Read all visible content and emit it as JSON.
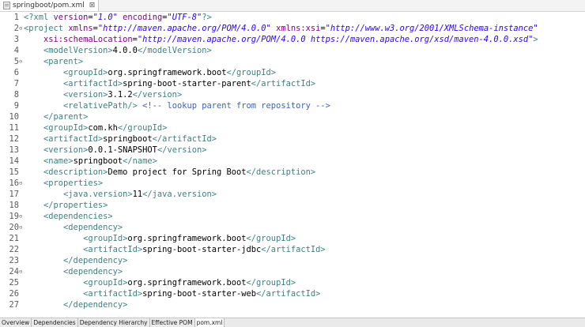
{
  "tab": {
    "label": "springboot/pom.xml",
    "close": "⊠"
  },
  "code_lines": [
    {
      "n": "1",
      "fold": "",
      "segs": [
        [
          "t",
          "<?"
        ],
        [
          "t",
          "xml "
        ],
        [
          "a",
          "version"
        ],
        [
          "x",
          "="
        ],
        [
          "v",
          "\"1.0\""
        ],
        [
          "x",
          " "
        ],
        [
          "a",
          "encoding"
        ],
        [
          "x",
          "="
        ],
        [
          "v",
          "\"UTF-8\""
        ],
        [
          "t",
          "?>"
        ]
      ]
    },
    {
      "n": "2",
      "fold": "⊖",
      "segs": [
        [
          "t",
          "<project "
        ],
        [
          "a",
          "xmlns"
        ],
        [
          "x",
          "="
        ],
        [
          "v",
          "\"http://maven.apache.org/POM/4.0.0\""
        ],
        [
          "x",
          " "
        ],
        [
          "a",
          "xmlns:xsi"
        ],
        [
          "x",
          "="
        ],
        [
          "v",
          "\"http://www.w3.org/2001/XMLSchema-instance\""
        ]
      ]
    },
    {
      "n": "3",
      "fold": "",
      "segs": [
        [
          "x",
          "    "
        ],
        [
          "a",
          "xsi:schemaLocation"
        ],
        [
          "x",
          "="
        ],
        [
          "v",
          "\"http://maven.apache.org/POM/4.0.0 https://maven.apache.org/xsd/maven-4.0.0.xsd\""
        ],
        [
          "t",
          ">"
        ]
      ]
    },
    {
      "n": "4",
      "fold": "",
      "segs": [
        [
          "x",
          "    "
        ],
        [
          "t",
          "<modelVersion>"
        ],
        [
          "x",
          "4.0.0"
        ],
        [
          "t",
          "</modelVersion>"
        ]
      ]
    },
    {
      "n": "5",
      "fold": "⊖",
      "segs": [
        [
          "x",
          "    "
        ],
        [
          "t",
          "<parent>"
        ]
      ]
    },
    {
      "n": "6",
      "fold": "",
      "segs": [
        [
          "x",
          "        "
        ],
        [
          "t",
          "<groupId>"
        ],
        [
          "x",
          "org.springframework.boot"
        ],
        [
          "t",
          "</groupId>"
        ]
      ]
    },
    {
      "n": "7",
      "fold": "",
      "segs": [
        [
          "x",
          "        "
        ],
        [
          "t",
          "<artifactId>"
        ],
        [
          "x",
          "spring-boot-starter-parent"
        ],
        [
          "t",
          "</artifactId>"
        ]
      ]
    },
    {
      "n": "8",
      "fold": "",
      "segs": [
        [
          "x",
          "        "
        ],
        [
          "t",
          "<version>"
        ],
        [
          "x",
          "3.1.2"
        ],
        [
          "t",
          "</version>"
        ]
      ]
    },
    {
      "n": "9",
      "fold": "",
      "segs": [
        [
          "x",
          "        "
        ],
        [
          "t",
          "<relativePath/>"
        ],
        [
          "x",
          " "
        ],
        [
          "c",
          "<!-- lookup parent from repository -->"
        ]
      ]
    },
    {
      "n": "10",
      "fold": "",
      "segs": [
        [
          "x",
          "    "
        ],
        [
          "t",
          "</parent>"
        ]
      ]
    },
    {
      "n": "11",
      "fold": "",
      "segs": [
        [
          "x",
          "    "
        ],
        [
          "t",
          "<groupId>"
        ],
        [
          "x",
          "com.kh"
        ],
        [
          "t",
          "</groupId>"
        ]
      ]
    },
    {
      "n": "12",
      "fold": "",
      "segs": [
        [
          "x",
          "    "
        ],
        [
          "t",
          "<artifactId>"
        ],
        [
          "x",
          "springboot"
        ],
        [
          "t",
          "</artifactId>"
        ]
      ]
    },
    {
      "n": "13",
      "fold": "",
      "segs": [
        [
          "x",
          "    "
        ],
        [
          "t",
          "<version>"
        ],
        [
          "x",
          "0.0.1-SNAPSHOT"
        ],
        [
          "t",
          "</version>"
        ]
      ]
    },
    {
      "n": "14",
      "fold": "",
      "segs": [
        [
          "x",
          "    "
        ],
        [
          "t",
          "<name>"
        ],
        [
          "x",
          "springboot"
        ],
        [
          "t",
          "</name>"
        ]
      ]
    },
    {
      "n": "15",
      "fold": "",
      "segs": [
        [
          "x",
          "    "
        ],
        [
          "t",
          "<description>"
        ],
        [
          "x",
          "Demo project for Spring Boot"
        ],
        [
          "t",
          "</description>"
        ]
      ]
    },
    {
      "n": "16",
      "fold": "⊖",
      "segs": [
        [
          "x",
          "    "
        ],
        [
          "t",
          "<properties>"
        ]
      ]
    },
    {
      "n": "17",
      "fold": "",
      "segs": [
        [
          "x",
          "        "
        ],
        [
          "t",
          "<java.version>"
        ],
        [
          "x",
          "11"
        ],
        [
          "t",
          "</java.version>"
        ]
      ]
    },
    {
      "n": "18",
      "fold": "",
      "segs": [
        [
          "x",
          "    "
        ],
        [
          "t",
          "</properties>"
        ]
      ]
    },
    {
      "n": "19",
      "fold": "⊖",
      "segs": [
        [
          "x",
          "    "
        ],
        [
          "t",
          "<dependencies>"
        ]
      ]
    },
    {
      "n": "20",
      "fold": "⊖",
      "segs": [
        [
          "x",
          "        "
        ],
        [
          "t",
          "<dependency>"
        ]
      ]
    },
    {
      "n": "21",
      "fold": "",
      "segs": [
        [
          "x",
          "            "
        ],
        [
          "t",
          "<groupId>"
        ],
        [
          "x",
          "org.springframework.boot"
        ],
        [
          "t",
          "</groupId>"
        ]
      ]
    },
    {
      "n": "22",
      "fold": "",
      "segs": [
        [
          "x",
          "            "
        ],
        [
          "t",
          "<artifactId>"
        ],
        [
          "x",
          "spring-boot-starter-jdbc"
        ],
        [
          "t",
          "</artifactId>"
        ]
      ]
    },
    {
      "n": "23",
      "fold": "",
      "segs": [
        [
          "x",
          "        "
        ],
        [
          "t",
          "</dependency>"
        ]
      ]
    },
    {
      "n": "24",
      "fold": "⊖",
      "segs": [
        [
          "x",
          "        "
        ],
        [
          "t",
          "<dependency>"
        ]
      ]
    },
    {
      "n": "25",
      "fold": "",
      "segs": [
        [
          "x",
          "            "
        ],
        [
          "t",
          "<groupId>"
        ],
        [
          "x",
          "org.springframework.boot"
        ],
        [
          "t",
          "</groupId>"
        ]
      ]
    },
    {
      "n": "26",
      "fold": "",
      "segs": [
        [
          "x",
          "            "
        ],
        [
          "t",
          "<artifactId>"
        ],
        [
          "x",
          "spring-boot-starter-web"
        ],
        [
          "t",
          "</artifactId>"
        ]
      ]
    },
    {
      "n": "27",
      "fold": "",
      "segs": [
        [
          "x",
          "        "
        ],
        [
          "t",
          "</dependency>"
        ]
      ]
    }
  ],
  "bottom_tabs": [
    {
      "label": "Overview",
      "active": false
    },
    {
      "label": "Dependencies",
      "active": false
    },
    {
      "label": "Dependency Hierarchy",
      "active": false
    },
    {
      "label": "Effective POM",
      "active": false
    },
    {
      "label": "pom.xml",
      "active": true
    }
  ]
}
